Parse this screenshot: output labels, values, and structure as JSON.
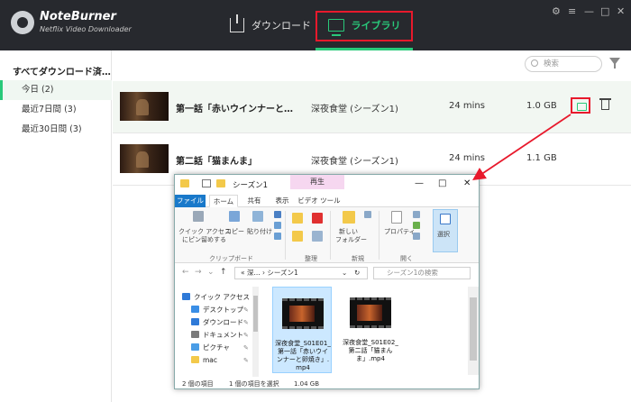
{
  "app": {
    "brand_name": "NoteBurner",
    "brand_sub": "Netflix Video Downloader",
    "accent": "#29c97a",
    "highlight": "#e8192c",
    "nav": {
      "download": "ダウンロード",
      "library": "ライブラリ"
    },
    "window_controls": [
      "⚙",
      "≡",
      "—",
      "□",
      "✕"
    ]
  },
  "sidebar": {
    "header": "すべてダウンロード済…",
    "items": [
      {
        "label": "今日 (2)",
        "active": true
      },
      {
        "label": "最近7日間 (3)",
        "active": false
      },
      {
        "label": "最近30日間 (3)",
        "active": false
      }
    ]
  },
  "search": {
    "placeholder": "検索"
  },
  "rows": [
    {
      "title": "第一話「赤いウインナーと…",
      "series": "深夜食堂 (シーズン1)",
      "duration": "24 mins",
      "size": "1.0 GB"
    },
    {
      "title": "第二話「猫まんま」",
      "series": "深夜食堂 (シーズン1)",
      "duration": "24 mins",
      "size": "1.1 GB"
    }
  ],
  "explorer": {
    "title_path": "シーズン1",
    "context_tab": "再生",
    "context_sub": "ビデオ ツール",
    "controls": [
      "—",
      "□",
      "✕"
    ],
    "tabs": [
      "ファイル",
      "ホーム",
      "共有",
      "表示",
      "ビデオ ツール"
    ],
    "ribbon": {
      "pin_label_1": "クイック アクセス",
      "pin_label_2": "にピン留めする",
      "copy": "コピー",
      "paste": "貼り付け",
      "clipboard_group": "クリップボード",
      "organize_group": "整理",
      "new_folder_1": "新しい",
      "new_folder_2": "フォルダー",
      "new_group": "新規",
      "properties": "プロパティ",
      "open_group": "開く",
      "select": "選択"
    },
    "address": {
      "crumb_1": "«",
      "crumb_2": "深...",
      "crumb_sep": "›",
      "crumb_3": "シーズン1",
      "dropdown": "⌄",
      "refresh": "↻"
    },
    "search_placeholder": "シーズン1の検索",
    "nav_items": [
      {
        "label": "クイック アクセス",
        "color": "#2f7ad8"
      },
      {
        "label": "デスクトップ",
        "color": "#3a8ee6"
      },
      {
        "label": "ダウンロード",
        "color": "#2f7ad8"
      },
      {
        "label": "ドキュメント",
        "color": "#7a7a7a"
      },
      {
        "label": "ピクチャ",
        "color": "#4a9de6"
      },
      {
        "label": "mac",
        "color": "#f3c94a"
      }
    ],
    "files": [
      {
        "name": "深夜食堂_S01E01_第一話「赤いウインナーと卵焼き」.mp4",
        "selected": true
      },
      {
        "name": "深夜食堂_S01E02_第二話「猫まんま」.mp4",
        "selected": false
      }
    ],
    "status": {
      "count": "2 個の項目",
      "selected": "1 個の項目を選択",
      "size": "1.04 GB"
    }
  }
}
